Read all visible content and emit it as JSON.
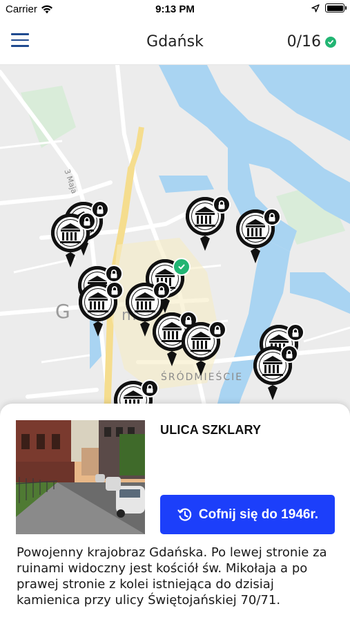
{
  "status_bar": {
    "carrier": "Carrier",
    "time": "9:13 PM",
    "icons": [
      "wifi-icon",
      "location-arrow-icon",
      "battery-icon"
    ]
  },
  "nav": {
    "menu_icon": "hamburger-menu-icon",
    "title": "Gdańsk",
    "progress": "0/16",
    "progress_icon": "check-circle-icon"
  },
  "map": {
    "labels": {
      "street": "3 Maja",
      "city": "G",
      "city_suffix": "m",
      "district": "ŚRÓDMIEŚCIE"
    },
    "pins": [
      {
        "id": 1,
        "icon": "museum-icon",
        "status": "locked"
      },
      {
        "id": 2,
        "icon": "museum-icon",
        "status": "locked"
      },
      {
        "id": 3,
        "icon": "museum-icon",
        "status": "locked"
      },
      {
        "id": 4,
        "icon": "museum-icon",
        "status": "locked"
      },
      {
        "id": 5,
        "icon": "museum-icon",
        "status": "visited"
      },
      {
        "id": 6,
        "icon": "museum-icon",
        "status": "locked"
      },
      {
        "id": 7,
        "icon": "museum-icon",
        "status": "locked"
      },
      {
        "id": 8,
        "icon": "museum-icon",
        "status": "locked"
      },
      {
        "id": 9,
        "icon": "museum-icon",
        "status": "locked"
      },
      {
        "id": 10,
        "icon": "museum-icon",
        "status": "locked"
      },
      {
        "id": 11,
        "icon": "museum-icon",
        "status": "locked"
      },
      {
        "id": 12,
        "icon": "museum-icon",
        "status": "locked"
      },
      {
        "id": 13,
        "icon": "museum-icon",
        "status": "locked"
      }
    ]
  },
  "sheet": {
    "title": "ULICA SZKLARY",
    "button_label": "Cofnij się do 1946r.",
    "button_icon": "history-clock-icon",
    "description": "Powojenny krajobraz Gdańska. Po lewej stronie za ruinami widoczny jest kościół św. Mikołaja a po prawej stronie z kolei istniejąca do dzisiaj kamienica przy ulicy Świętojańskiej 70/71."
  },
  "colors": {
    "accent_blue": "#1c3ffa",
    "menu_blue": "#1f4a8f",
    "success_green": "#22b573",
    "water": "#a9d4f2",
    "park": "#cfead2",
    "road_yellow": "#f5dd8e"
  }
}
